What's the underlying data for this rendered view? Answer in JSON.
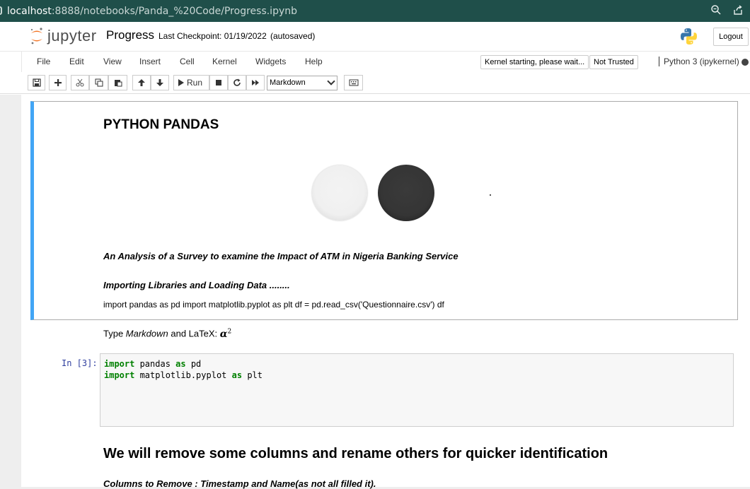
{
  "browser": {
    "url_host": "localhost",
    "url_rest": ":8888/notebooks/Panda_%20Code/Progress.ipynb"
  },
  "header": {
    "logo_text": "jupyter",
    "notebook_name": "Progress",
    "checkpoint": "Last Checkpoint: 01/19/2022",
    "autosaved": "(autosaved)",
    "logout_label": "Logout"
  },
  "menu": {
    "items": [
      "File",
      "Edit",
      "View",
      "Insert",
      "Cell",
      "Kernel",
      "Widgets",
      "Help"
    ],
    "kernel_status": "Kernel starting, please wait...",
    "trust_status": "Not Trusted",
    "kernel_name": "Python 3 (ipykernel)"
  },
  "toolbar": {
    "run_label": "Run",
    "cell_type": "Markdown"
  },
  "cells": {
    "title": "PYTHON PANDAS",
    "subtitle": "An Analysis of a Survey to examine the Impact of ATM in Nigeria Banking Service",
    "importing": "Importing Libraries and Loading Data ........",
    "import_code": "import pandas as pd import matplotlib.pyplot as plt df = pd.read_csv('Questionnaire.csv') df",
    "hint_prefix": "Type ",
    "hint_markdown": "Markdown",
    "hint_suffix": " and LaTeX: ",
    "hint_alpha": "α",
    "hint_sup": "2",
    "code_prompt": "In [3]:",
    "code_line1_kw": "import",
    "code_line1_mid": " pandas ",
    "code_line1_kw2": "as",
    "code_line1_end": " pd",
    "code_line2_kw": "import",
    "code_line2_mid": " matplotlib.pyplot ",
    "code_line2_kw2": "as",
    "code_line2_end": " plt",
    "heading2": "We will remove some columns and rename others for quicker identification",
    "columns_note": "Columns to Remove : Timestamp and Name(as not all filled it)."
  },
  "colors": {
    "url_bar": "#1f4f4a",
    "selected_cell_border": "#42a5f5",
    "prompt_blue": "#303f9f",
    "keyword_green": "#008000",
    "jupyter_orange": "#f37626"
  }
}
